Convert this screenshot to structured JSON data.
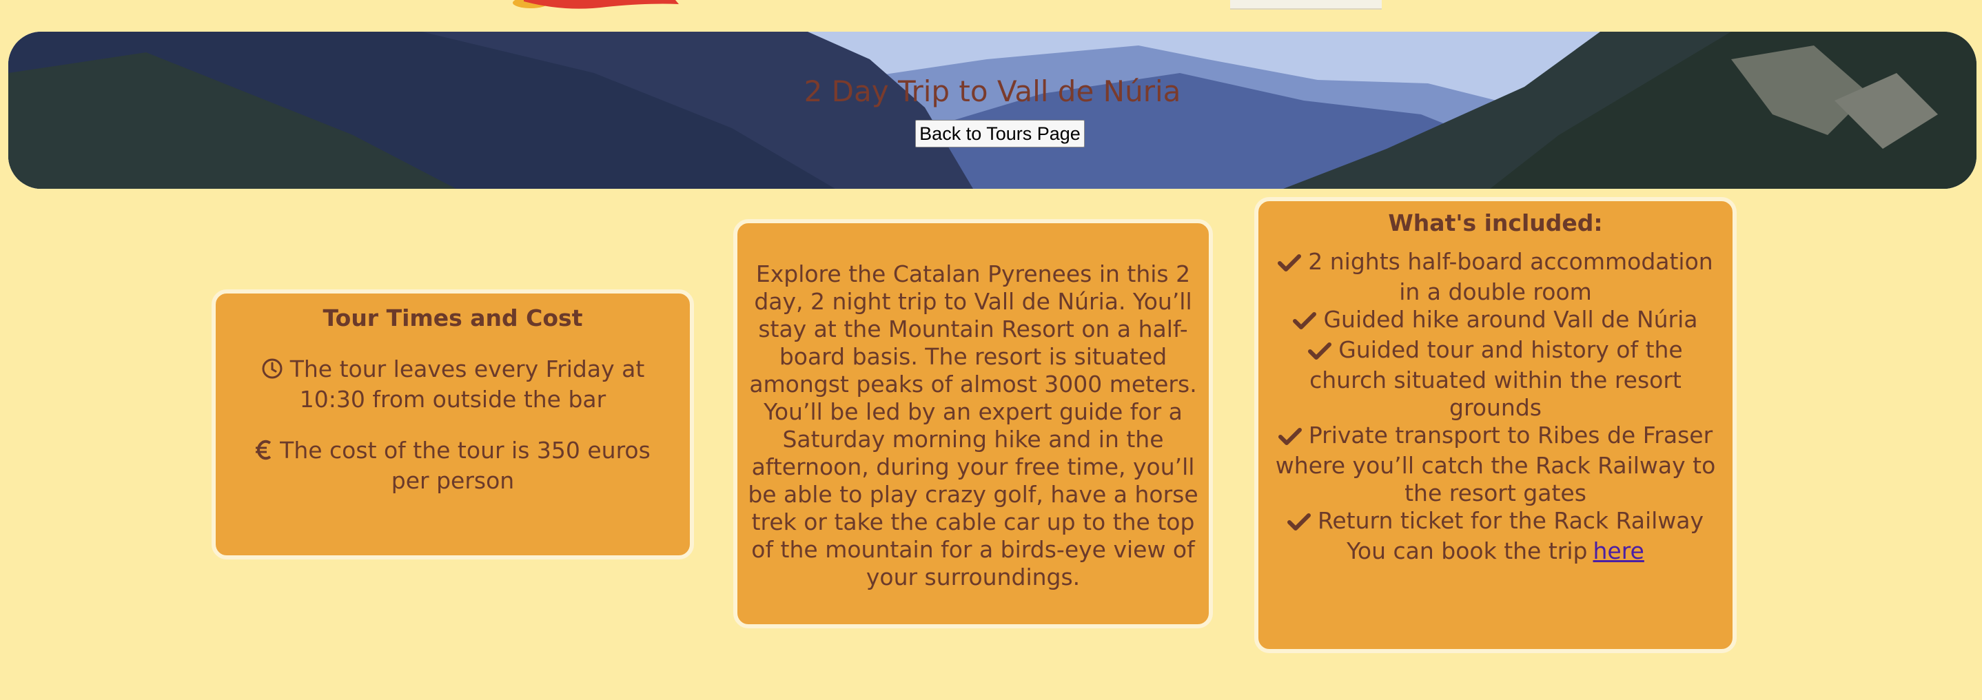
{
  "hero": {
    "title": "2 Day Trip to Vall de Núria",
    "back_button": "Back to Tours Page"
  },
  "times_card": {
    "heading": "Tour Times and Cost",
    "departure": "The tour leaves every Friday at 10:30 from outside the bar",
    "cost": "The cost of the tour is 350 euros per person",
    "icons": [
      "clock-icon",
      "euro-icon"
    ]
  },
  "description_card": {
    "text": "Explore the Catalan Pyrenees in this 2 day, 2 night trip to Vall de Núria. You’ll stay at the Mountain Resort on a half-board basis. The resort is situated amongst peaks of almost 3000 meters. You’ll be led by an expert guide for a Saturday morning hike and in the afternoon, during your free time, you’ll be able to play crazy golf, have a horse trek or take the cable car up to the top of the mountain for a birds-eye view of your surroundings."
  },
  "included_card": {
    "heading": "What's included:",
    "items": [
      "2 nights half-board accommodation in a double room",
      "Guided hike around Vall de Núria",
      "Guided tour and history of the church situated within the resort grounds",
      "Private transport to Ribes de Fraser where you’ll catch the Rack Railway to the resort gates",
      "Return ticket for the Rack Railway"
    ],
    "booking_text": "You can book the trip",
    "booking_link": "here"
  },
  "colors": {
    "background": "#fdeca5",
    "card": "#eca43b",
    "text": "#6b3a2a",
    "link": "#4a1fa5"
  }
}
